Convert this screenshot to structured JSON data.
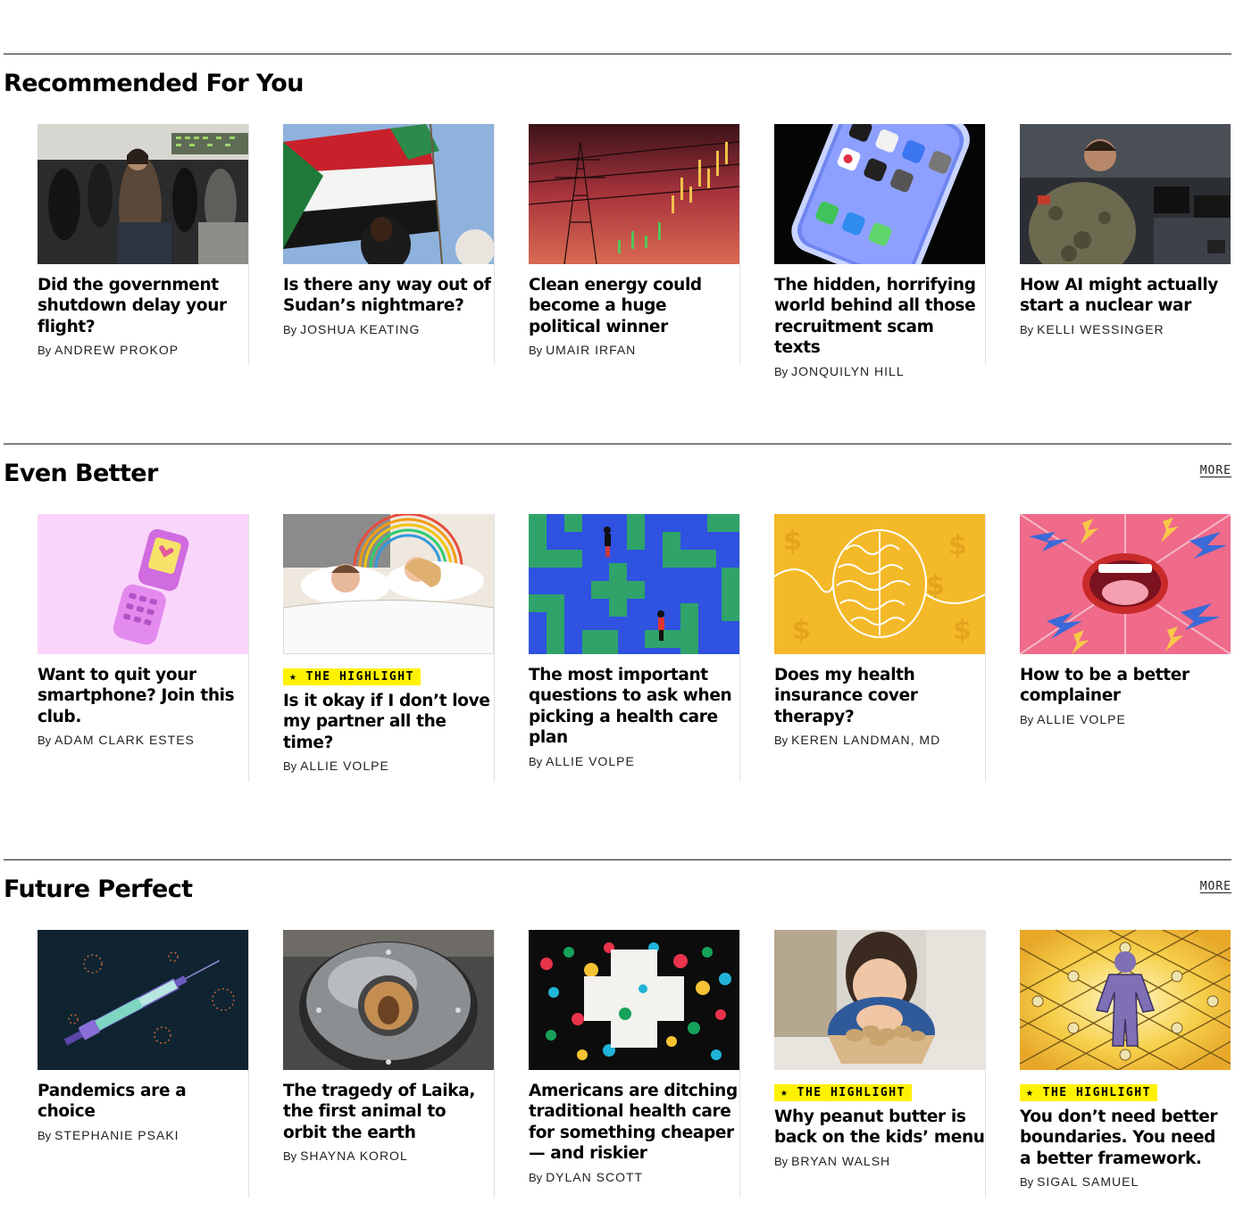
{
  "sections": [
    {
      "title": "Recommended For You",
      "more": "",
      "cards": [
        {
          "headline": "Did the government shutdown delay your flight?",
          "badge": "",
          "by": "By",
          "author": "ANDREW PROKOP"
        },
        {
          "headline": "Is there any way out of Sudan’s nightmare?",
          "badge": "",
          "by": "By",
          "author": "JOSHUA KEATING"
        },
        {
          "headline": "Clean energy could become a huge political winner",
          "badge": "",
          "by": "By",
          "author": "UMAIR IRFAN"
        },
        {
          "headline": "The hidden, horrifying world behind all those recruitment scam texts",
          "badge": "",
          "by": "By",
          "author": "JONQUILYN HILL"
        },
        {
          "headline": "How AI might actually start a nuclear war",
          "badge": "",
          "by": "By",
          "author": "KELLI WESSINGER"
        }
      ]
    },
    {
      "title": "Even Better",
      "more": "MORE",
      "cards": [
        {
          "headline": "Want to quit your smartphone? Join this club.",
          "badge": "",
          "by": "By",
          "author": "ADAM CLARK ESTES"
        },
        {
          "headline": "Is it okay if I don’t love my partner all the time?",
          "badge": "★ THE HIGHLIGHT",
          "by": "By",
          "author": "ALLIE VOLPE"
        },
        {
          "headline": "The most important questions to ask when picking a health care plan",
          "badge": "",
          "by": "By",
          "author": "ALLIE VOLPE"
        },
        {
          "headline": "Does my health insurance cover therapy?",
          "badge": "",
          "by": "By",
          "author": "KEREN LANDMAN, MD"
        },
        {
          "headline": "How to be a better complainer",
          "badge": "",
          "by": "By",
          "author": "ALLIE VOLPE"
        }
      ]
    },
    {
      "title": "Future Perfect",
      "more": "MORE",
      "cards": [
        {
          "headline": "Pandemics are a choice",
          "badge": "",
          "by": "By",
          "author": "STEPHANIE PSAKI"
        },
        {
          "headline": "The tragedy of Laika, the first animal to orbit the earth",
          "badge": "",
          "by": "By",
          "author": "SHAYNA KOROL"
        },
        {
          "headline": "Americans are ditching traditional health care for something cheaper — and riskier",
          "badge": "",
          "by": "By",
          "author": "DYLAN SCOTT"
        },
        {
          "headline": "Why peanut butter is back on the kids’ menu",
          "badge": "★ THE HIGHLIGHT",
          "by": "By",
          "author": "BRYAN WALSH"
        },
        {
          "headline": "You don’t need better boundaries. You need a better framework.",
          "badge": "★ THE HIGHLIGHT",
          "by": "By",
          "author": "SIGAL SAMUEL"
        }
      ]
    }
  ]
}
